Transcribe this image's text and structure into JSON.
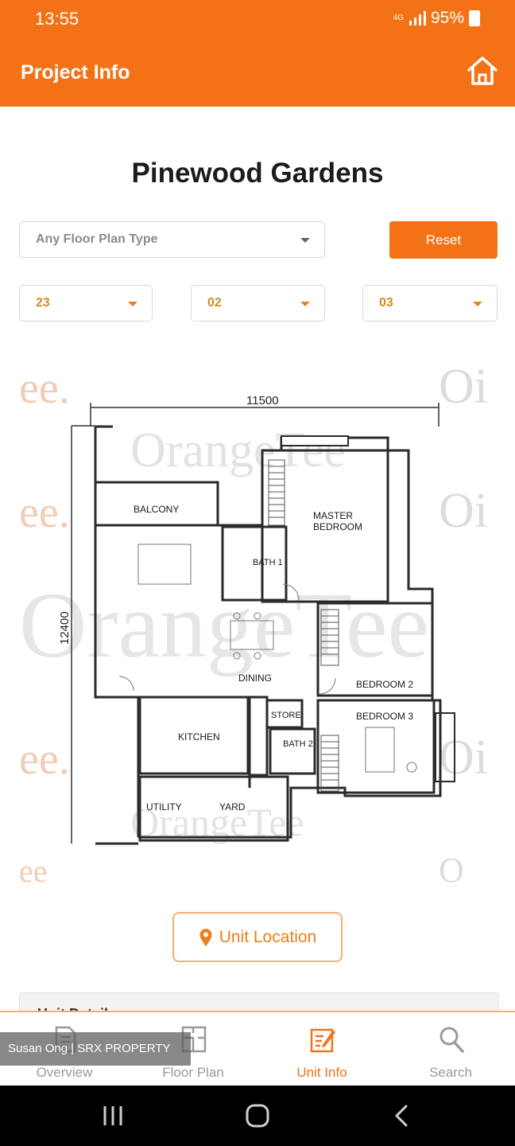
{
  "status_bar": {
    "time": "13:55",
    "network": "4G",
    "battery": "95%"
  },
  "app_bar": {
    "title": "Project Info",
    "home_icon": "home-icon"
  },
  "project": {
    "name": "Pinewood Gardens"
  },
  "filters": {
    "floor_plan_type": {
      "value": "Any Floor Plan Type"
    },
    "reset_label": "Reset",
    "block": "23",
    "floor": "02",
    "unit": "03"
  },
  "floor_plan": {
    "width_label": "11500",
    "depth_label": "12400",
    "watermark_text": "OrangeTee",
    "rooms": {
      "balcony": "BALCONY",
      "master": "MASTER",
      "bedroom": "BEDROOM",
      "bath1": "BATH 1",
      "dining": "DINING",
      "bedroom2": "BEDROOM 2",
      "store": "STORE",
      "bedroom3": "BEDROOM 3",
      "kitchen": "KITCHEN",
      "bath2": "BATH 2",
      "utility": "UTILITY",
      "yard": "YARD"
    }
  },
  "unit_location": {
    "label": "Unit Location",
    "icon": "map-pin-icon"
  },
  "unit_details": {
    "label": "Unit Details"
  },
  "bottom_nav": {
    "items": [
      {
        "label": "Overview",
        "icon": "document-icon"
      },
      {
        "label": "Floor Plan",
        "icon": "floor-plan-icon"
      },
      {
        "label": "Unit Info",
        "icon": "unit-info-icon"
      },
      {
        "label": "Search",
        "icon": "search-icon"
      }
    ],
    "active": "Unit Info"
  },
  "overlay_caption": "Susan Ong | SRX PROPERTY",
  "colors": {
    "brand": "#f47216",
    "accent_text": "#e8811c"
  }
}
